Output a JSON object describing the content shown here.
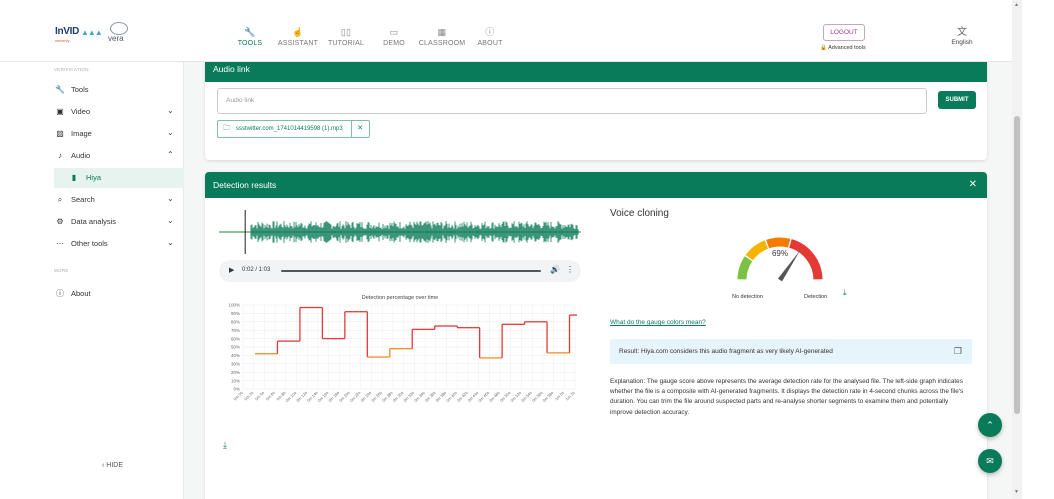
{
  "brand": {
    "invid": "InVID",
    "vera": "vera",
    "subtitle": "weverify"
  },
  "nav": [
    {
      "label": "TOOLS",
      "icon": "wrench-icon",
      "glyph": "🔧",
      "active": true
    },
    {
      "label": "ASSISTANT",
      "icon": "assistant-icon",
      "glyph": "☝",
      "active": false
    },
    {
      "label": "TUTORIAL",
      "icon": "book-icon",
      "glyph": "▯▯",
      "active": false
    },
    {
      "label": "DEMO",
      "icon": "demo-icon",
      "glyph": "▭",
      "active": false
    },
    {
      "label": "CLASSROOM",
      "icon": "classroom-icon",
      "glyph": "▦",
      "active": false
    },
    {
      "label": "ABOUT",
      "icon": "info-icon",
      "glyph": "ⓘ",
      "active": false
    }
  ],
  "header": {
    "logout": "LOGOUT",
    "advanced_tools": "Advanced tools",
    "language": "English"
  },
  "sidebar": {
    "section_verification": "VERIFICATION",
    "section_more": "MORE",
    "items": [
      {
        "label": "Tools",
        "icon": "wrench-icon",
        "glyph": "🔧",
        "chevron": ""
      },
      {
        "label": "Video",
        "icon": "video-icon",
        "glyph": "▣",
        "chevron": "⌄"
      },
      {
        "label": "Image",
        "icon": "image-icon",
        "glyph": "▨",
        "chevron": "⌄"
      },
      {
        "label": "Audio",
        "icon": "music-note-icon",
        "glyph": "♪",
        "chevron": "⌃"
      },
      {
        "label": "Hiya",
        "icon": "hiya-icon",
        "glyph": "▮",
        "chevron": "",
        "active": true
      },
      {
        "label": "Search",
        "icon": "search-icon",
        "glyph": "⌕",
        "chevron": "⌄"
      },
      {
        "label": "Data analysis",
        "icon": "data-analysis-icon",
        "glyph": "⚙",
        "chevron": "⌄"
      },
      {
        "label": "Other tools",
        "icon": "more-dots-icon",
        "glyph": "⋯",
        "chevron": "⌄"
      },
      {
        "label": "About",
        "icon": "info-icon",
        "glyph": "ⓘ",
        "chevron": ""
      }
    ],
    "hide": "‹ HIDE"
  },
  "audio_link": {
    "title": "Audio link",
    "placeholder": "Audio link",
    "submit": "SUBMIT",
    "file_name": "ssstwitter.com_1741014419598 (1).mp3"
  },
  "detection": {
    "title": "Detection results",
    "close": "✕",
    "player": {
      "time": "0:02 / 1:03",
      "progress": 0.03
    },
    "voice_cloning": "Voice cloning",
    "gauge": {
      "percent": "69%",
      "value": 69,
      "no_detection": "No detection",
      "detection": "Detection"
    },
    "gauge_link": "What do the gauge colors mean?",
    "result": "Result: Hiya.com considers this audio fragment as very likely AI-generated",
    "explanation": "Explanation: The gauge score above represents the average detection rate for the analysed file. The left-side graph indicates whether the file is a composite with AI-generated fragments. It displays the detection rate in 4-second chunks across the file's duration. You can trim the file around suspected parts and re-analyse shorter segments to examine them and potentially improve detection accuracy."
  },
  "chart_data": {
    "type": "line",
    "title": "Detection percentage over time",
    "xlabel": "",
    "ylabel": "",
    "ylim": [
      0,
      100
    ],
    "yticks": [
      "0%",
      "10%",
      "20%",
      "30%",
      "40%",
      "50%",
      "60%",
      "70%",
      "80%",
      "90%",
      "100%"
    ],
    "categories": [
      "0m 0s",
      "0m 2s",
      "0m 4s",
      "0m 6s",
      "0m 8s",
      "0m 10s",
      "0m 12s",
      "0m 14s",
      "0m 16s",
      "0m 18s",
      "0m 20s",
      "0m 22s",
      "0m 24s",
      "0m 26s",
      "0m 28s",
      "0m 30s",
      "0m 32s",
      "0m 34s",
      "0m 36s",
      "0m 38s",
      "0m 40s",
      "0m 42s",
      "0m 44s",
      "0m 46s",
      "0m 48s",
      "0m 50s",
      "0m 52s",
      "0m 54s",
      "0m 56s",
      "0m 58s",
      "1m 0s",
      "1m 2s"
    ],
    "series": [
      {
        "values": [
          42,
          42,
          42,
          57,
          57,
          57,
          97,
          97,
          97,
          60,
          60,
          60,
          92,
          92,
          92,
          38,
          38,
          38,
          48,
          48,
          48,
          71,
          71,
          71,
          75,
          75,
          75,
          73,
          73,
          73,
          37,
          37,
          37,
          77,
          77,
          77,
          80,
          80,
          80,
          43,
          43,
          43,
          88,
          88
        ]
      }
    ],
    "grid": true
  },
  "colors": {
    "accent": "#0a7b5a",
    "result_bg": "#e6f4fb",
    "line_high": "#e53935",
    "line_low": "#f28c28"
  }
}
